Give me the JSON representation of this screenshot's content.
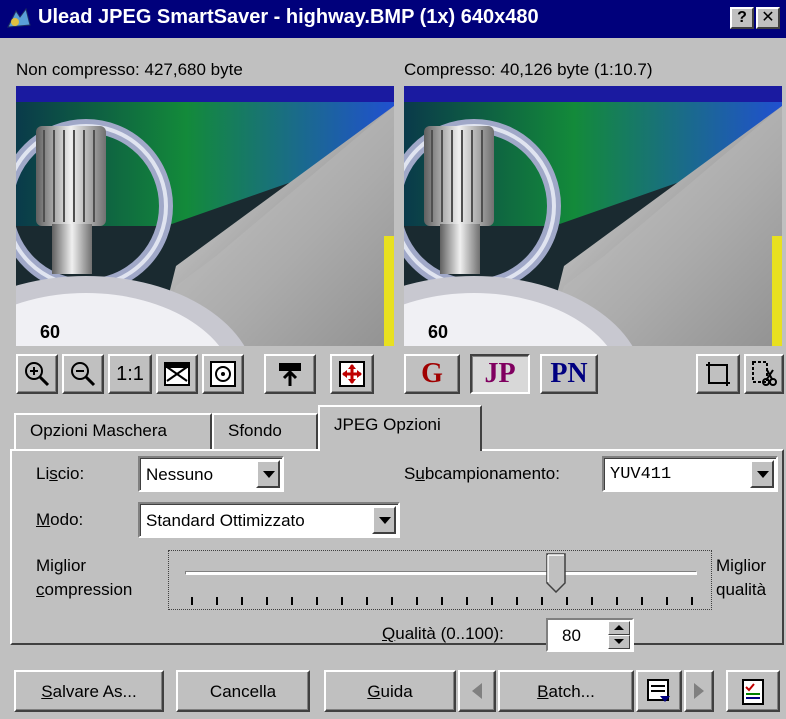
{
  "window": {
    "title": "Ulead JPEG SmartSaver - highway.BMP (1x) 640x480",
    "help_label": "?",
    "close_label": "✕"
  },
  "labels": {
    "uncompressed": "Non compresso: 427,680 byte",
    "compressed": "Compresso: 40,126 byte (1:10.7)"
  },
  "preview": {
    "dial_number": "60"
  },
  "toolbar": {
    "actual_size": "1:1",
    "gif_label": "G",
    "jpg_label": "JP",
    "png_label": "PN"
  },
  "tabs": [
    {
      "label": "Opzioni Maschera"
    },
    {
      "label": "Sfondo"
    },
    {
      "label": "JPEG Opzioni"
    }
  ],
  "jpeg_options": {
    "smoothing_label": "Liscio:",
    "smoothing_value": "Nessuno",
    "subsampling_label": "Subcampionamento:",
    "subsampling_value": "YUV411",
    "mode_label": "Modo:",
    "mode_value": "Standard Ottimizzato",
    "best_compression_line1": "Miglior",
    "best_compression_line2": "compression",
    "best_quality_line1": "Miglior",
    "best_quality_line2": "qualità",
    "quality_label": "Qualità (0..100):",
    "quality_value": "80",
    "slider_fraction": 0.73
  },
  "buttons": {
    "save_as": "Salvare As...",
    "cancel": "Cancella",
    "help": "Guida",
    "batch": "Batch..."
  },
  "colors": {
    "title_bar": "#00007b",
    "button_face": "#c0c0c0",
    "gif_red": "#a00000",
    "jpg_purple": "#800060",
    "png_blue": "#000080"
  }
}
